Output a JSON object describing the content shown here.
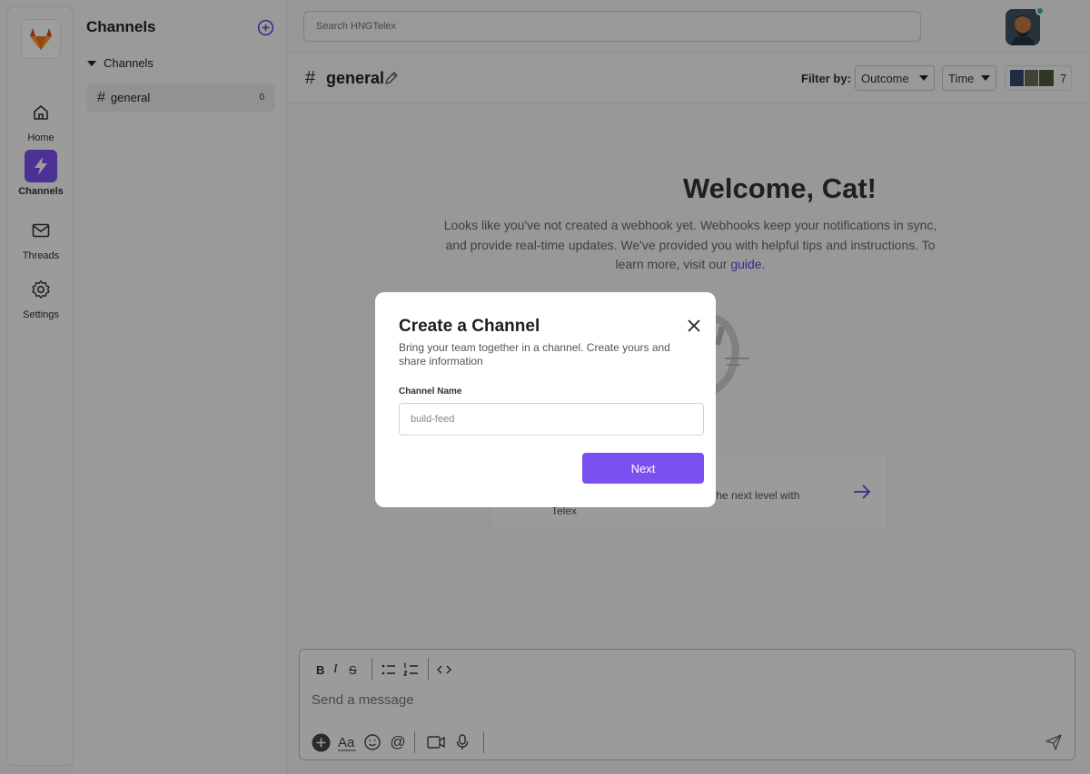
{
  "rail": {
    "items": [
      {
        "label": "Home",
        "icon": "home-icon"
      },
      {
        "label": "Channels",
        "icon": "bolt-icon",
        "active": true
      },
      {
        "label": "Threads",
        "icon": "mail-icon"
      },
      {
        "label": "Settings",
        "icon": "gear-icon"
      }
    ]
  },
  "sidebar": {
    "title": "Channels",
    "group_label": "Channels",
    "channels": [
      {
        "name": "general",
        "count": "0"
      }
    ]
  },
  "search": {
    "placeholder": "Search HNGTelex"
  },
  "channel_header": {
    "name": "general",
    "filter_label": "Filter by:",
    "filters": [
      "Outcome",
      "Time"
    ],
    "member_count": "7"
  },
  "welcome": {
    "title": "Welcome, Cat!",
    "text": "Looks like you've not created a webhook yet. Webhooks keep your notifications in sync, and provide real-time updates. We've provided you with helpful tips and instructions. To learn more, visit our",
    "link": "guide."
  },
  "card": {
    "text": "o the next level with",
    "text2": "Telex"
  },
  "composer": {
    "placeholder": "Send a message"
  },
  "modal": {
    "title": "Create a Channel",
    "subtitle": "Bring your team together in a channel. Create yours and share information",
    "field_label": "Channel Name",
    "field_placeholder": "build-feed",
    "next_label": "Next"
  },
  "colors": {
    "accent": "#7b50f0",
    "link": "#5f3fe0",
    "online": "#22c55e"
  }
}
